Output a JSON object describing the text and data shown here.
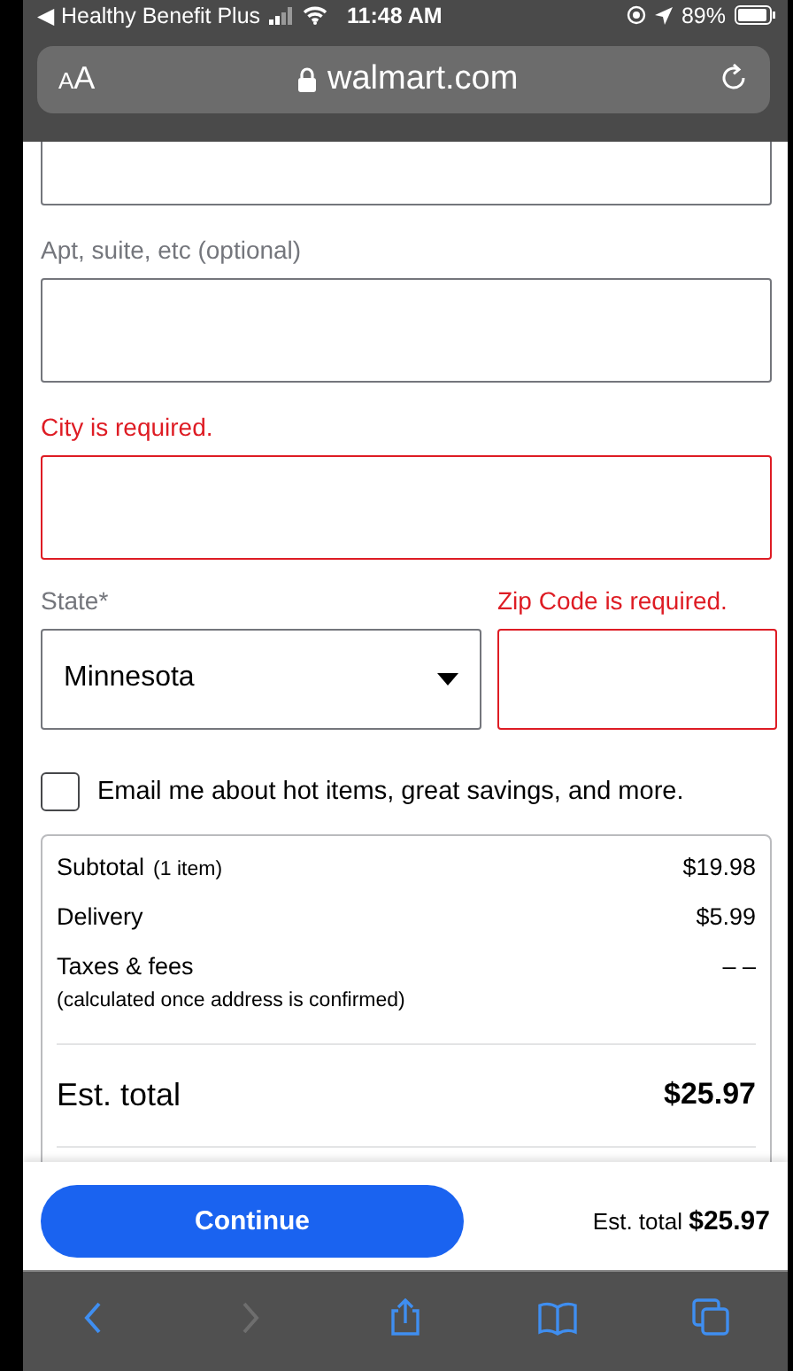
{
  "status_bar": {
    "back_app": "◀ Healthy Benefit Plus",
    "time": "11:48 AM",
    "battery": "89%"
  },
  "url_bar": {
    "text_size": "AA",
    "address": "walmart.com"
  },
  "form": {
    "fields": [
      {
        "error": false
      },
      {
        "label": "Apt, suite, etc (optional)",
        "error": false
      },
      {
        "label": "City is required.",
        "error": true
      }
    ],
    "state": {
      "label": "State*",
      "value": "Minnesota",
      "error": false
    },
    "zip": {
      "label": "Zip Code is required.",
      "error": true
    },
    "email_opt_in": {
      "label": "Email me about hot items, great savings, and more.",
      "checked": false
    }
  },
  "summary": {
    "rows": [
      {
        "label": "Subtotal",
        "note": "(1 item)",
        "value": "$19.98"
      },
      {
        "label": "Delivery",
        "value": "$5.99"
      },
      {
        "label": "Taxes & fees",
        "note": "(calculated once address is confirmed)",
        "value": "– –"
      }
    ],
    "total_label": "Est. total",
    "total_value": "$25.97"
  },
  "footer": {
    "button": "Continue",
    "total_label": "Est. total",
    "total_value": "$25.97"
  },
  "toolbar": [
    {
      "kind": "back",
      "disabled": false
    },
    {
      "kind": "forward",
      "disabled": true
    },
    {
      "kind": "share",
      "disabled": false
    },
    {
      "kind": "bookmarks",
      "disabled": false
    },
    {
      "kind": "tabs",
      "disabled": false
    }
  ]
}
